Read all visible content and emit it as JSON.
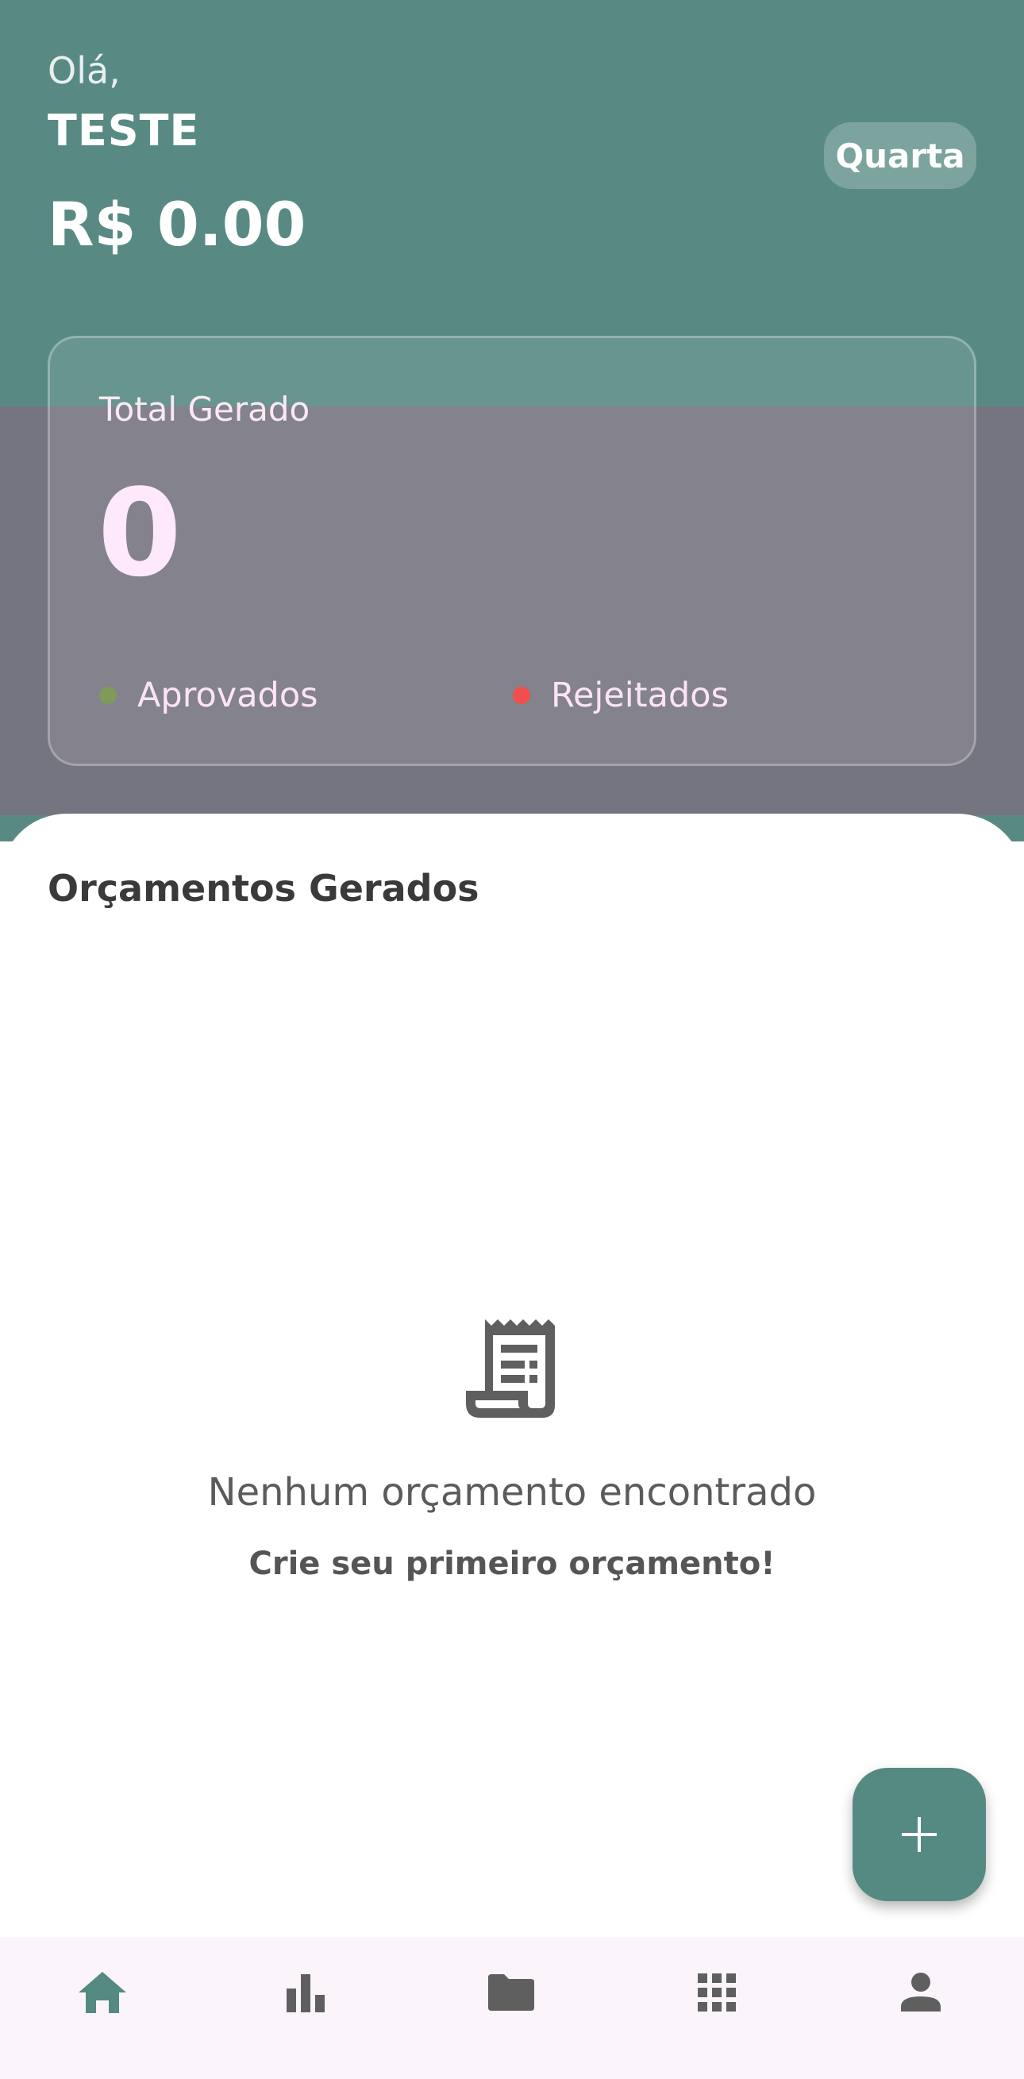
{
  "header": {
    "greeting": "Olá,",
    "user_name": "TESTE",
    "balance": "R$ 0.00",
    "day_chip": "Quarta"
  },
  "stats": {
    "label": "Total Gerado",
    "value": "0",
    "legend": [
      {
        "label": "Aprovados",
        "color": "#7f9a5a"
      },
      {
        "label": "Rejeitados",
        "color": "#f24e4e"
      }
    ]
  },
  "budgets": {
    "title": "Orçamentos Gerados",
    "empty_icon": "receipt-icon",
    "empty_title": "Nenhum orçamento encontrado",
    "empty_subtitle": "Crie seu primeiro orçamento!"
  },
  "fab": {
    "icon": "plus-icon"
  },
  "bottom_nav": {
    "items": [
      {
        "icon": "home-icon",
        "active": true
      },
      {
        "icon": "bar-chart-icon",
        "active": false
      },
      {
        "icon": "folder-icon",
        "active": false
      },
      {
        "icon": "apps-grid-icon",
        "active": false
      },
      {
        "icon": "person-icon",
        "active": false
      }
    ]
  },
  "colors": {
    "primary": "#588a83",
    "purple_band": "#757481",
    "nav_background": "#fcf4fb",
    "icon_inactive": "#5f5f5f"
  }
}
